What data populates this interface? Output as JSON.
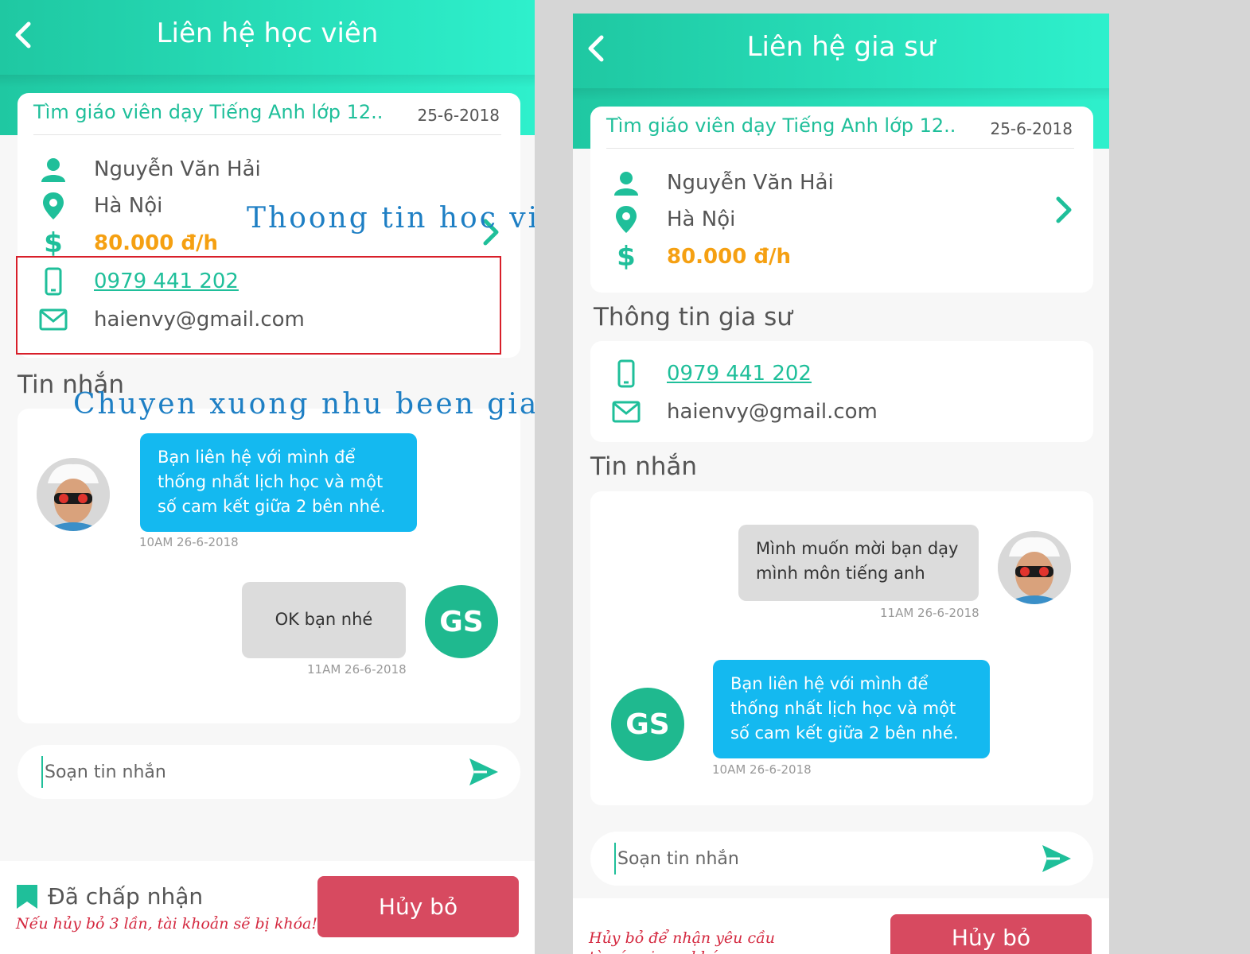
{
  "left": {
    "header_title": "Liên hệ học viên",
    "job_title": "Tìm giáo viên dạy Tiếng Anh lớp 12..",
    "job_date": "25-6-2018",
    "name": "Nguyễn Văn Hải",
    "location": "Hà Nội",
    "price": "80.000 đ/h",
    "phone": "0979 441 202",
    "email": "haienvy@gmail.com",
    "messages_label": "Tin nhắn",
    "msg1_text": "Bạn liên hệ với mình để thống nhất lịch học và một số cam kết giữa 2 bên nhé.",
    "msg1_time": "10AM  26-6-2018",
    "msg2_text": "OK bạn nhé",
    "msg2_time": "11AM  26-6-2018",
    "avatar_initials": "GS",
    "composer_placeholder": "Soạn tin nhắn",
    "status_label": "Đã chấp nhận",
    "warning": "Nếu hủy bỏ 3 lần, tài khoản sẽ bị khóa!",
    "cancel_label": "Hủy bỏ"
  },
  "right": {
    "header_title": "Liên hệ gia sư",
    "job_title": "Tìm giáo viên dạy Tiếng Anh lớp 12..",
    "job_date": "25-6-2018",
    "name": "Nguyễn Văn Hải",
    "location": "Hà Nội",
    "price": "80.000 đ/h",
    "tutor_info_label": "Thông tin gia sư",
    "phone": "0979 441 202",
    "email": "haienvy@gmail.com",
    "messages_label": "Tin nhắn",
    "msg1_text": "Mình muốn mời bạn dạy mình môn tiếng anh",
    "msg1_time": "11AM  26-6-2018",
    "msg2_text": "Bạn liên hệ với mình để thống nhất lịch học và một số cam kết giữa 2 bên nhé.",
    "msg2_time": "10AM  26-6-2018",
    "avatar_initials": "GS",
    "composer_placeholder": "Soạn tin nhắn",
    "warning": "Hủy bỏ để nhận yêu cầu từ các gia sư khác",
    "cancel_label": "Hủy bỏ"
  },
  "annotations": {
    "info_note": "Thoong tin hoc vien",
    "move_note": "Chuyen xuong nhu been gia su",
    "annotation_color": "#1e7fc4",
    "highlight_color": "#d81f2a"
  },
  "colors": {
    "accent": "#1fc8a2",
    "price": "#f5a012",
    "bubble_blue": "#14b9f0",
    "bubble_gray": "#dcdcdc",
    "cancel": "#d74a60"
  },
  "icons": [
    "back-icon",
    "user-icon",
    "location-pin-icon",
    "dollar-icon",
    "phone-icon",
    "mail-icon",
    "chevron-right-icon",
    "send-icon",
    "bookmark-icon"
  ]
}
